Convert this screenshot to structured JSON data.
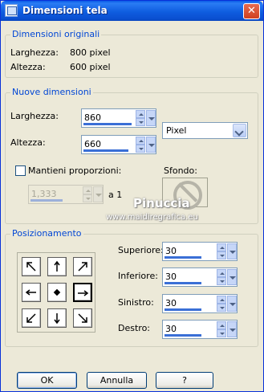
{
  "title_bar": {
    "title": "Dimensioni tela",
    "close_glyph": "✕"
  },
  "original_dimensions": {
    "legend": "Dimensioni originali",
    "width_label": "Larghezza:",
    "width_value": "800 pixel",
    "height_label": "Altezza:",
    "height_value": "600 pixel"
  },
  "new_dimensions": {
    "legend": "Nuove dimensioni",
    "width_label": "Larghezza:",
    "width_value": "860",
    "height_label": "Altezza:",
    "height_value": "660",
    "unit_selected": "Pixel",
    "keep_proportions_label": "Mantieni proporzioni:",
    "keep_proportions_checked": false,
    "ratio_value": "1,333",
    "ratio_suffix": "a 1",
    "background_label": "Sfondo:"
  },
  "positioning": {
    "legend": "Posizionamento",
    "anchors": [
      {
        "name": "top-left",
        "icon": "arrow-up-left-icon"
      },
      {
        "name": "top",
        "icon": "arrow-up-icon"
      },
      {
        "name": "top-right",
        "icon": "arrow-up-right-icon"
      },
      {
        "name": "left",
        "icon": "arrow-left-icon"
      },
      {
        "name": "center",
        "icon": "center-dot-icon"
      },
      {
        "name": "right",
        "icon": "arrow-right-icon"
      },
      {
        "name": "bottom-left",
        "icon": "arrow-down-left-icon"
      },
      {
        "name": "bottom",
        "icon": "arrow-down-icon"
      },
      {
        "name": "bottom-right",
        "icon": "arrow-down-right-icon"
      }
    ],
    "selected_anchor": "right",
    "top_label": "Superiore:",
    "top_value": "30",
    "bottom_label": "Inferiore:",
    "bottom_value": "30",
    "left_label": "Sinistro:",
    "left_value": "30",
    "right_label": "Destro:",
    "right_value": "30"
  },
  "buttons": {
    "ok": "OK",
    "cancel": "Annulla",
    "help": "?"
  },
  "watermark": {
    "name": "Pinuccia",
    "url": "www.maidiregrafica.eu"
  },
  "colors": {
    "title_bar": "#0a5ae6",
    "legend_text": "#0046d5",
    "window_bg": "#ece9d8"
  }
}
